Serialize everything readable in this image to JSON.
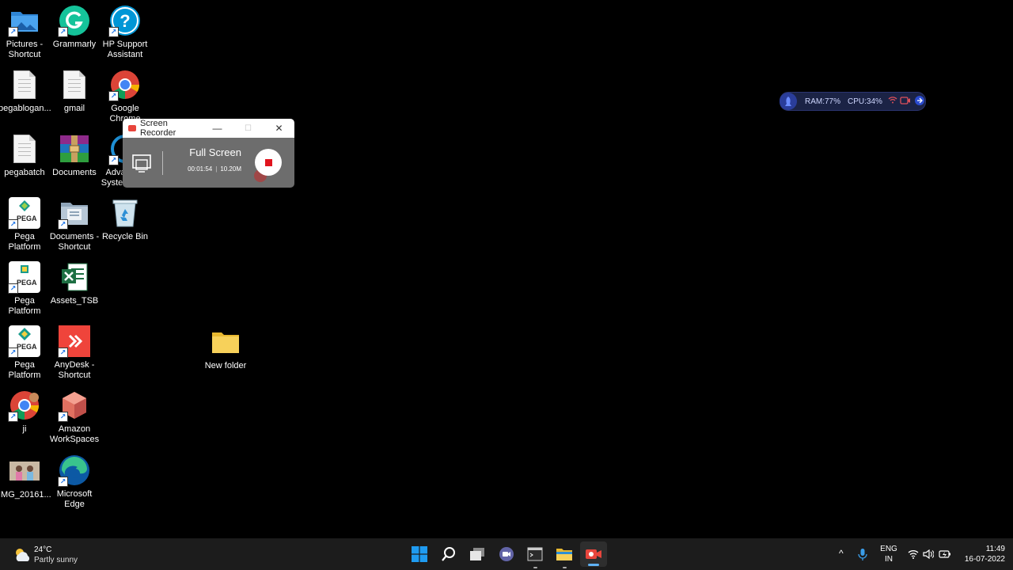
{
  "desktop": {
    "icons": [
      {
        "label": "Pictures - Shortcut"
      },
      {
        "label": "Grammarly"
      },
      {
        "label": "HP Support Assistant"
      },
      {
        "label": "pegablogan..."
      },
      {
        "label": "gmail"
      },
      {
        "label": "Google Chrome"
      },
      {
        "label": "pegabatch"
      },
      {
        "label": "Documents"
      },
      {
        "label": "Advanced SystemCare"
      },
      {
        "label": "Pega Platform 8.6..."
      },
      {
        "label": "Documents - Shortcut"
      },
      {
        "label": "Recycle Bin"
      },
      {
        "label": "Pega Platform 8.6..."
      },
      {
        "label": "Assets_TSB"
      },
      {
        "label": "Pega Platform 8.6..."
      },
      {
        "label": "AnyDesk - Shortcut"
      },
      {
        "label": "ji"
      },
      {
        "label": "Amazon WorkSpaces"
      },
      {
        "label": "IMG_20161..."
      },
      {
        "label": "Microsoft Edge"
      },
      {
        "label": "New folder"
      }
    ],
    "pega_badge": "PEGA"
  },
  "recorder": {
    "title": "Screen Recorder",
    "mode": "Full Screen",
    "elapsed": "00:01:54",
    "size": "10.20M",
    "minimize_glyph": "—",
    "maximize_glyph": "☐",
    "close_glyph": "✕"
  },
  "monitor": {
    "ram": "RAM:77%",
    "cpu": "CPU:34%"
  },
  "taskbar": {
    "weather": {
      "temp": "24°C",
      "condition": "Partly sunny"
    },
    "lang": {
      "line1": "ENG",
      "line2": "IN"
    },
    "clock": {
      "time": "11:49",
      "date": "16-07-2022"
    },
    "chevron": "^"
  },
  "colors": {
    "taskbar": "#1c1c1c",
    "recorder_body": "#6d6d6d",
    "record_red": "#e0141e",
    "win_blue": "#1f9bf0"
  }
}
